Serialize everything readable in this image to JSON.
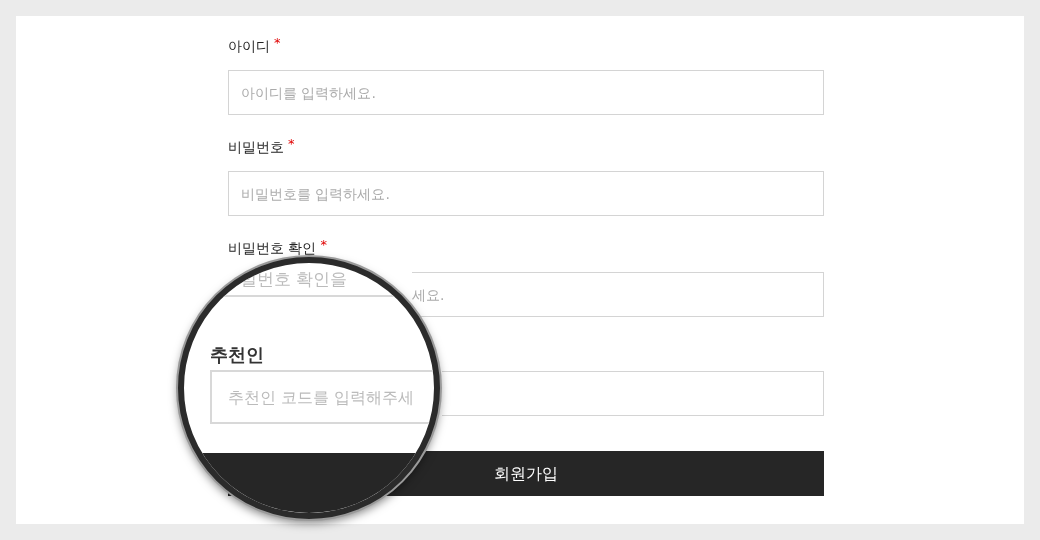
{
  "fields": [
    {
      "label": "아이디",
      "required_mark": "*",
      "covered": false,
      "placeholder": "아이디를 입력하세요."
    },
    {
      "label": "비밀번호",
      "required_mark": "*",
      "covered": false,
      "placeholder": "비밀번호를 입력하세요."
    },
    {
      "label": "비밀번호 확인",
      "required_mark": "*",
      "covered": true,
      "placeholder": "세요."
    }
  ],
  "magnifier": {
    "fragment": "밀번호 확인을",
    "label": "추천인",
    "placeholder": "추천인 코드를 입력해주세"
  },
  "submit_button": "회원가입"
}
